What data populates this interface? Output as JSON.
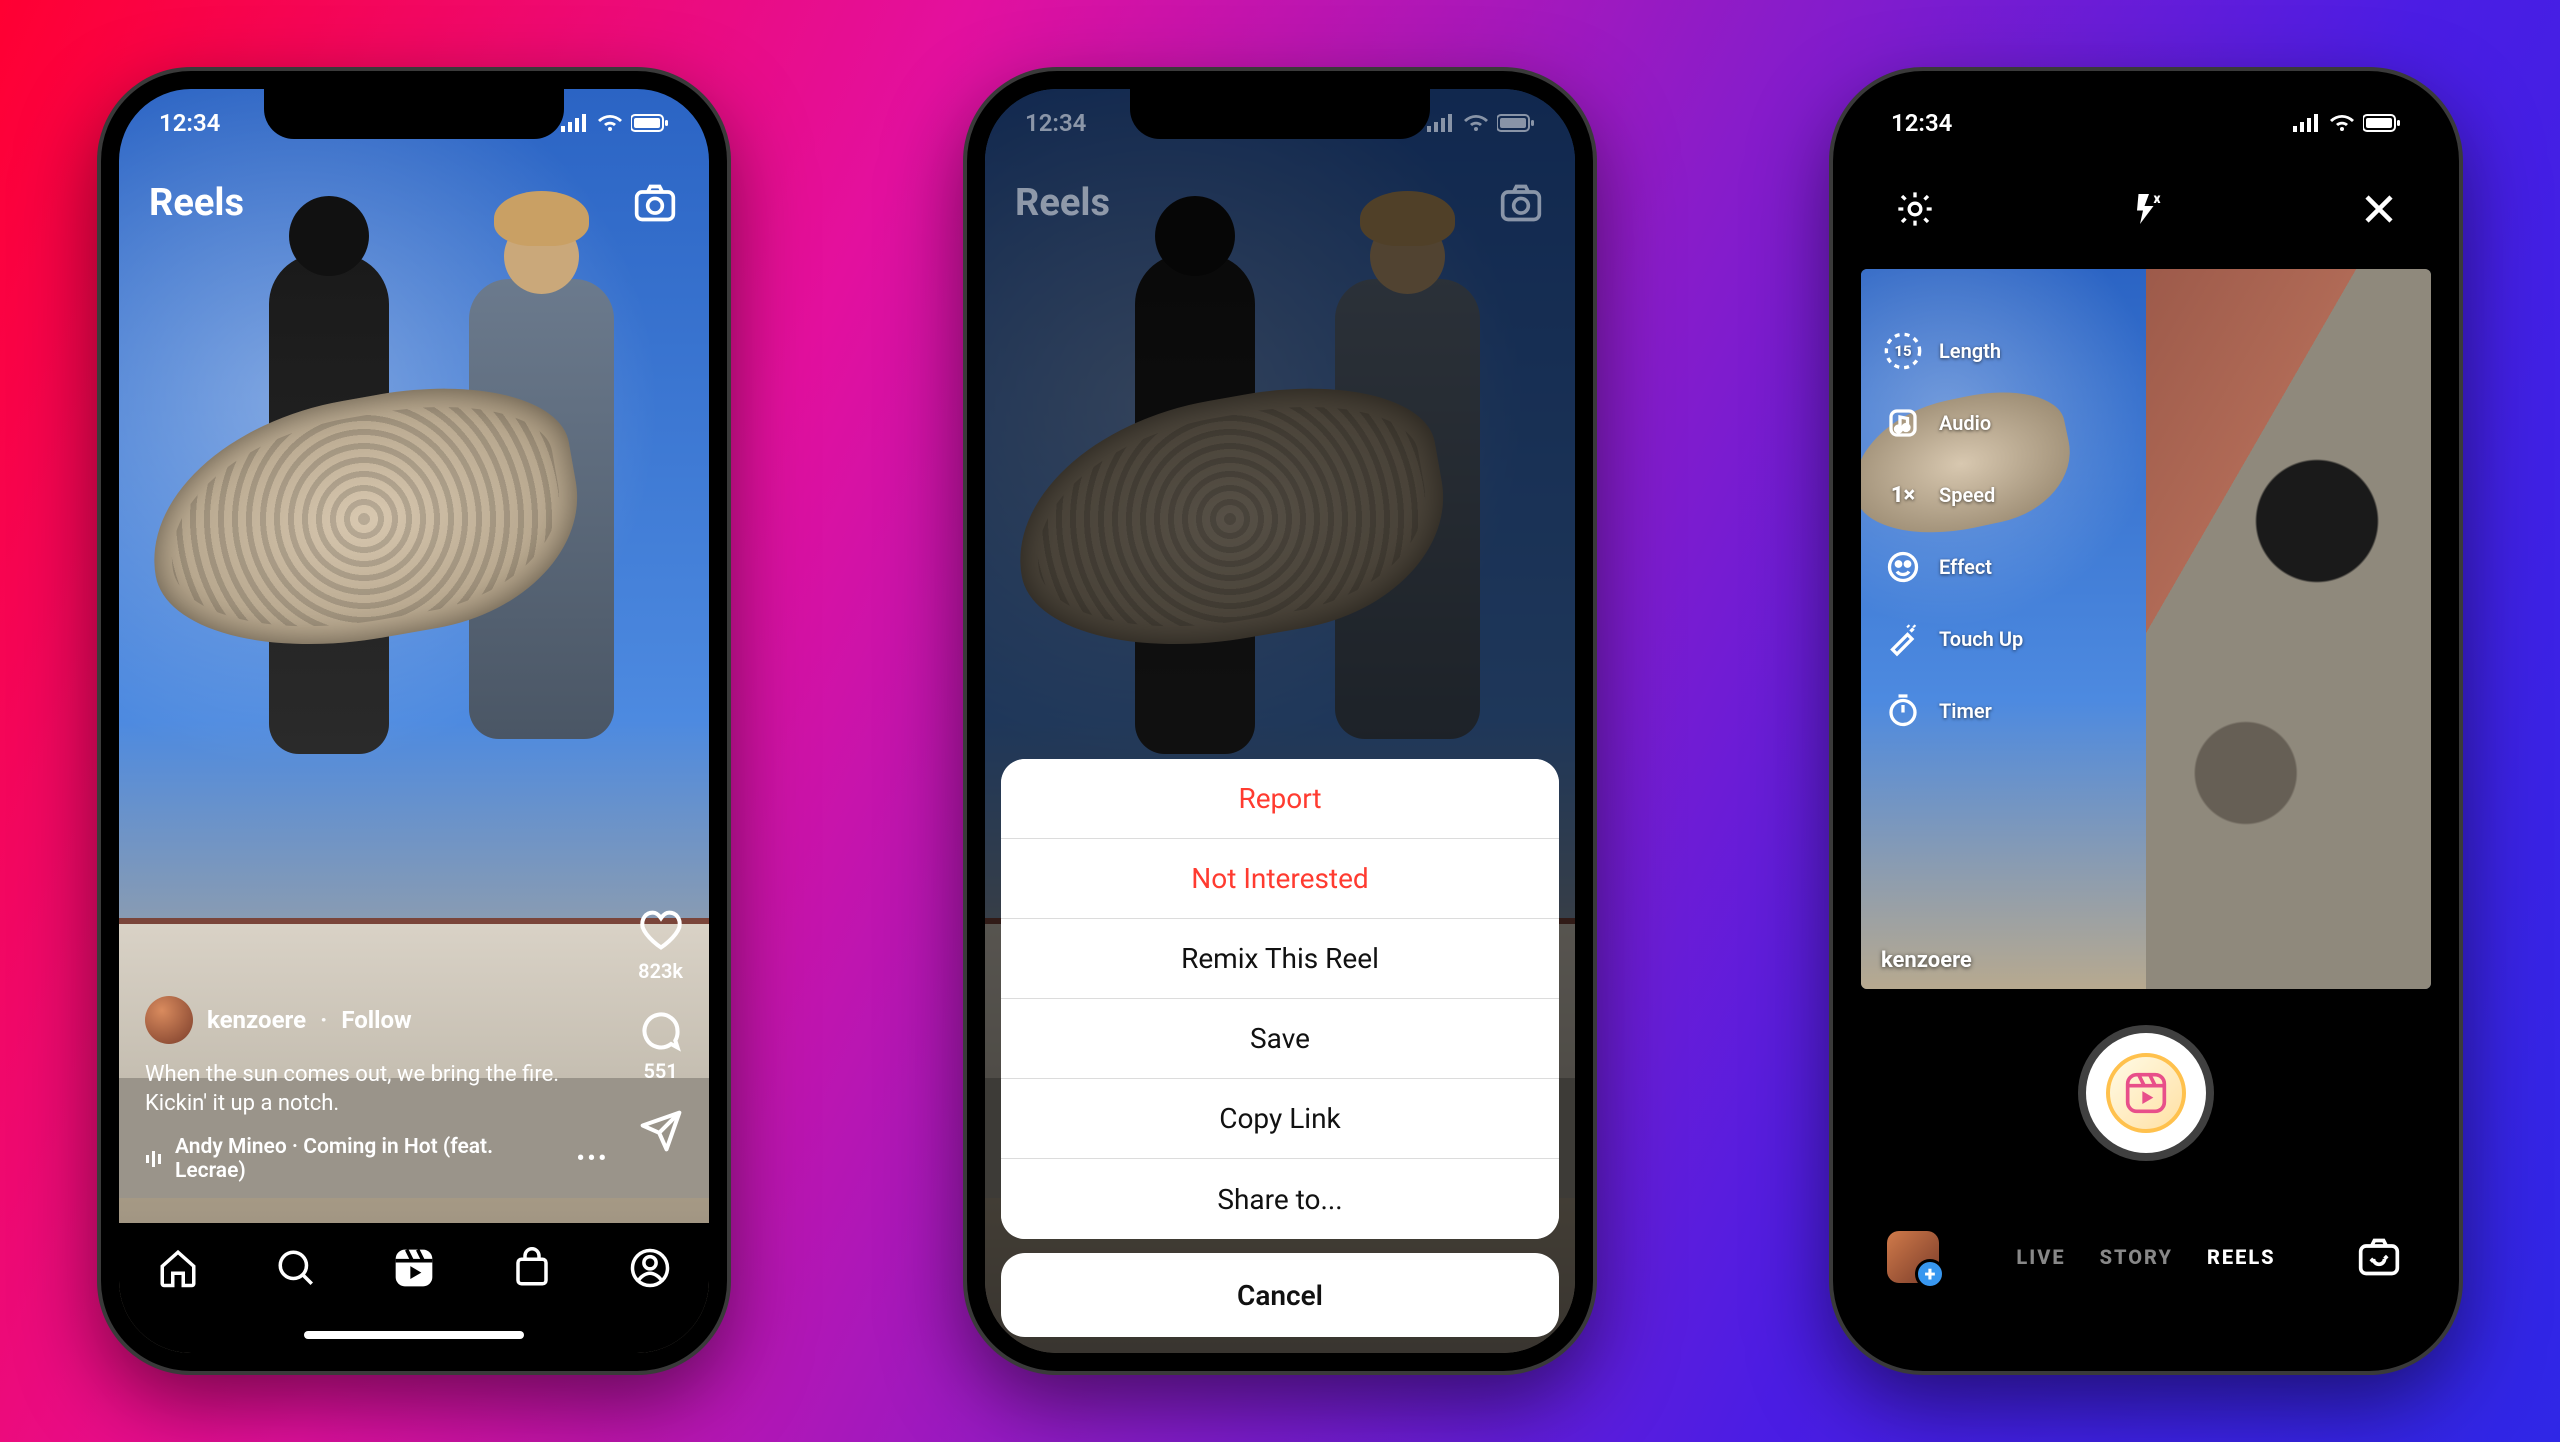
{
  "status": {
    "time": "12:34"
  },
  "phone1": {
    "header_title": "Reels",
    "username": "kenzoere",
    "follow_label": "Follow",
    "caption_line1": "When the sun comes out, we bring the fire.",
    "caption_line2": "Kickin' it up a notch.",
    "audio": "Andy Mineo · Coming in Hot (feat. Lecrae)",
    "likes": "823k",
    "comments": "551"
  },
  "phone2": {
    "header_title": "Reels",
    "sheet": {
      "report": "Report",
      "not_interested": "Not Interested",
      "remix": "Remix This Reel",
      "save": "Save",
      "copy_link": "Copy Link",
      "share_to": "Share to...",
      "cancel": "Cancel"
    }
  },
  "phone3": {
    "tools": {
      "length_value": "15",
      "length": "Length",
      "audio": "Audio",
      "speed_value": "1×",
      "speed": "Speed",
      "effect": "Effect",
      "touch_up": "Touch Up",
      "timer": "Timer"
    },
    "vf_username": "kenzoere",
    "modes": {
      "live": "LIVE",
      "story": "STORY",
      "reels": "REELS"
    }
  }
}
